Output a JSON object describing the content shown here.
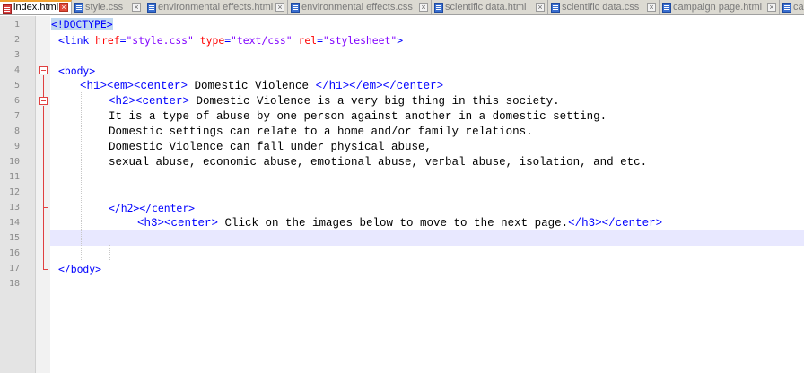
{
  "tabs": [
    {
      "label": "index.html",
      "active": true
    },
    {
      "label": "style.css",
      "active": false
    },
    {
      "label": "environmental effects.html",
      "active": false
    },
    {
      "label": "environmental effects.css",
      "active": false
    },
    {
      "label": "scientific data.html",
      "active": false
    },
    {
      "label": "scientific data.css",
      "active": false
    },
    {
      "label": "campaign page.html",
      "active": false
    },
    {
      "label": "ca",
      "active": false
    }
  ],
  "line_numbers": [
    "1",
    "2",
    "3",
    "4",
    "5",
    "6",
    "7",
    "8",
    "9",
    "10",
    "11",
    "12",
    "13",
    "14",
    "15",
    "16",
    "17",
    "18"
  ],
  "code": {
    "l1_doctype": "<!DOCTYPE>",
    "l2_open": "<link ",
    "l2_attr1": "href",
    "l2_eq1": "=",
    "l2_val1": "\"style.css\"",
    "l2_attr2": "type",
    "l2_eq2": "=",
    "l2_val2": "\"text/css\"",
    "l2_attr3": "rel",
    "l2_eq3": "=",
    "l2_val3": "\"stylesheet\"",
    "l2_close": ">",
    "l4_body": "<body>",
    "l5_tags_open": "<h1><em><center>",
    "l5_text": " Domestic Violence ",
    "l5_tags_close": "</h1></em></center>",
    "l6_tags_open": "<h2><center>",
    "l6_text": " Domestic Violence is a very big thing in this society.",
    "l7_text": "It is a type of abuse by one person against another in a domestic setting.",
    "l8_text": "Domestic settings can relate to a home and/or family relations.",
    "l9_text": "Domestic Violence can fall under physical abuse,",
    "l10_text": "sexual abuse, economic abuse, emotional abuse, verbal abuse, isolation, and etc.",
    "l13_tags": "</h2></center>",
    "l14_tags_open": "<h3><center>",
    "l14_text": " Click on the images below to move to the next page.",
    "l14_tags_close": "</h3></center>",
    "l17_body_close": "</body>"
  },
  "colors": {
    "tag": "#0000ff",
    "attribute": "#ff0000",
    "value": "#8000ff",
    "current_line": "#e8e8ff",
    "fold_marker": "#e04040"
  },
  "icons": {
    "tab_file": "file-icon",
    "tab_close": "close-icon",
    "fold": "fold-box-icon"
  }
}
